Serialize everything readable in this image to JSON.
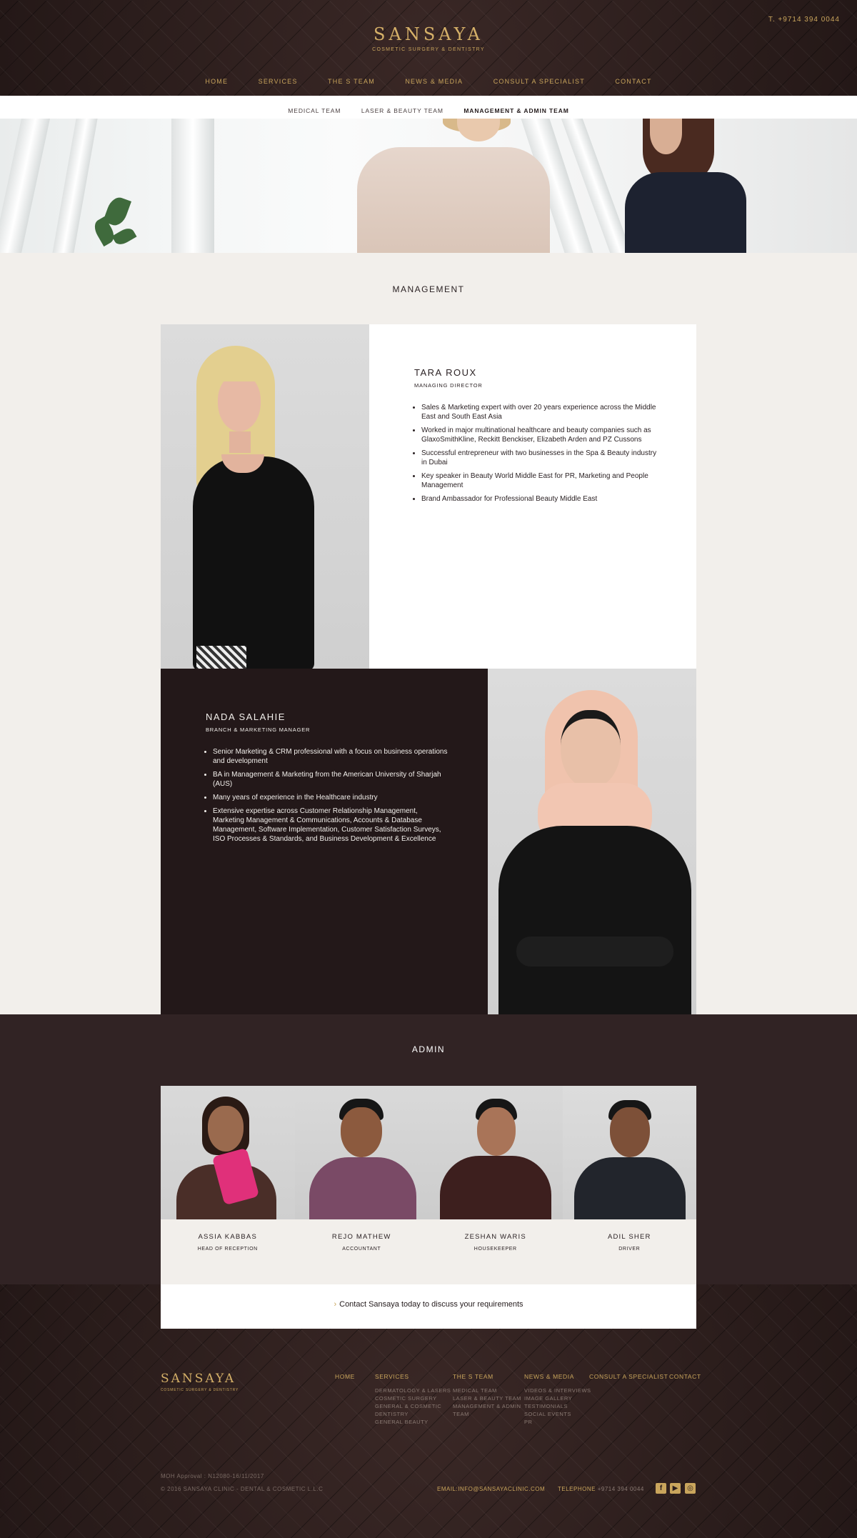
{
  "header": {
    "phone": "T. +9714 394 0044",
    "brand": "SANSAYA",
    "tagline": "COSMETIC SURGERY & DENTISTRY",
    "nav": [
      "HOME",
      "SERVICES",
      "THE S TEAM",
      "NEWS & MEDIA",
      "CONSULT A SPECIALIST",
      "CONTACT"
    ]
  },
  "subnav": {
    "items": [
      "MEDICAL TEAM",
      "LASER & BEAUTY TEAM",
      "MANAGEMENT & ADMIN TEAM"
    ],
    "active": "MANAGEMENT & ADMIN TEAM"
  },
  "management": {
    "title": "MANAGEMENT",
    "members": [
      {
        "name": "TARA ROUX",
        "role": "MANAGING DIRECTOR",
        "bullets": [
          "Sales & Marketing expert with over 20 years experience across the Middle East and South East Asia",
          "Worked in major multinational healthcare and beauty companies such as GlaxoSmithKline, Reckitt Benckiser, Elizabeth Arden and PZ Cussons",
          "Successful entrepreneur with two businesses in the Spa & Beauty industry in Dubai",
          "Key speaker in Beauty World Middle East for PR, Marketing and People Management",
          "Brand Ambassador for Professional Beauty Middle East"
        ]
      },
      {
        "name": "NADA SALAHIE",
        "role": "BRANCH & MARKETING MANAGER",
        "bullets": [
          "Senior Marketing & CRM professional with a focus on business operations and development",
          "BA in Management & Marketing from the American University of Sharjah (AUS)",
          "Many years of experience in the Healthcare industry",
          "Extensive expertise across Customer Relationship Management, Marketing Management & Communications, Accounts & Database Management, Software Implementation, Customer Satisfaction Surveys, ISO Processes & Standards, and Business Development & Excellence"
        ]
      }
    ]
  },
  "admin": {
    "title": "ADMIN",
    "members": [
      {
        "name": "ASSIA KABBAS",
        "role": "HEAD OF RECEPTION"
      },
      {
        "name": "REJO MATHEW",
        "role": "ACCOUNTANT"
      },
      {
        "name": "ZESHAN WARIS",
        "role": "HOUSEKEEPER"
      },
      {
        "name": "ADIL SHER",
        "role": "DRIVER"
      }
    ]
  },
  "cta": {
    "chevron": "›",
    "text": "Contact Sansaya today to discuss your requirements"
  },
  "footer": {
    "brand": "SANSAYA",
    "tagline": "COSMETIC SURGERY & DENTISTRY",
    "columns": [
      {
        "heading": "HOME",
        "items": []
      },
      {
        "heading": "SERVICES",
        "items": [
          "DERMATOLOGY & LASERS",
          "COSMETIC SURGERY",
          "GENERAL & COSMETIC",
          "DENTISTRY",
          "GENERAL BEAUTY"
        ]
      },
      {
        "heading": "THE S TEAM",
        "items": [
          "MEDICAL TEAM",
          "LASER & BEAUTY TEAM",
          "MANAGEMENT & ADMIN",
          "TEAM"
        ]
      },
      {
        "heading": "NEWS & MEDIA",
        "items": [
          "VIDEOS & INTERVIEWS",
          "IMAGE GALLERY",
          "TESTIMONIALS",
          "SOCIAL EVENTS",
          "PR"
        ]
      },
      {
        "heading": "CONSULT A SPECIALIST",
        "items": []
      },
      {
        "heading": "CONTACT",
        "items": []
      }
    ],
    "moh": "MOH Approval : N12080-16/11/2017",
    "copyright": "© 2016    SANSAYA CLINIC - DENTAL & COSMETIC L.L.C",
    "email": "EMAIL:INFO@SANSAYACLINIC.COM",
    "telephone_label": "TELEPHONE",
    "telephone": "+9714 394 0044",
    "social": [
      "facebook-icon",
      "youtube-icon",
      "instagram-icon"
    ]
  },
  "colors": {
    "gold": "#c9a55c",
    "dark_brown": "#2a1d1c",
    "admin_bg": "#312324",
    "panel_dark": "#231819",
    "page_bg": "#f2efeb"
  }
}
